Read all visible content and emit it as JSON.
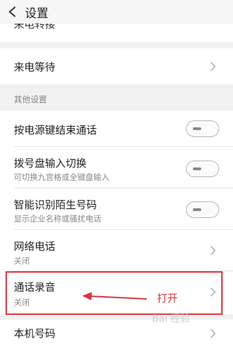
{
  "header": {
    "title": "设置"
  },
  "cut_row": {
    "label": "来电转接"
  },
  "rows": {
    "call_waiting": {
      "title": "来电等待"
    },
    "section_other": "其他设置",
    "power_end_call": {
      "title": "按电源键结束通话"
    },
    "dialpad_switch": {
      "title": "拨号盘输入切换",
      "subtitle": "可切换九宫格或全键盘输入"
    },
    "smart_identify": {
      "title": "智能识别陌生号码",
      "subtitle": "显示企业名称或骚扰电话"
    },
    "network_call": {
      "title": "网络电话",
      "subtitle": "关闭"
    },
    "call_recording": {
      "title": "通话录音",
      "subtitle": "关闭"
    },
    "my_number": {
      "title": "本机号码"
    }
  },
  "toggles": {
    "power_end_call": false,
    "dialpad_switch": false,
    "smart_identify": false
  },
  "annotation": {
    "text": "打开",
    "color": "#d9363e"
  },
  "watermark": {
    "text": "Bai 经验"
  }
}
